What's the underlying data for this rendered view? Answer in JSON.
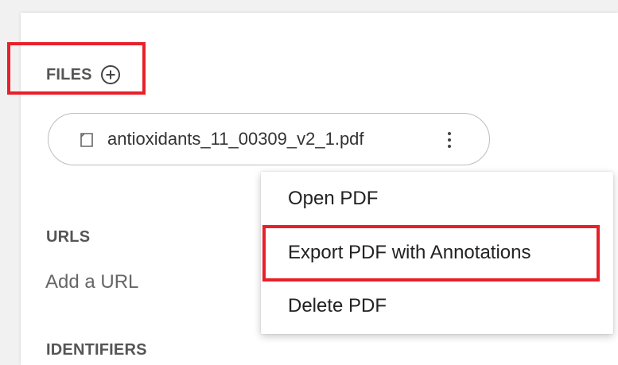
{
  "files": {
    "heading": "FILES",
    "add_icon": "plus-circle-icon",
    "file": {
      "icon": "document-icon",
      "name": "antioxidants_11_00309_v2_1.pdf",
      "more_icon": "kebab-menu-icon"
    }
  },
  "urls": {
    "heading": "URLS",
    "placeholder": "Add a URL"
  },
  "identifiers": {
    "heading": "IDENTIFIERS"
  },
  "context_menu": {
    "items": [
      {
        "label": "Open PDF"
      },
      {
        "label": "Export PDF with Annotations"
      },
      {
        "label": "Delete PDF"
      }
    ]
  },
  "colors": {
    "highlight": "#e8202a",
    "heading_text": "#555555"
  }
}
